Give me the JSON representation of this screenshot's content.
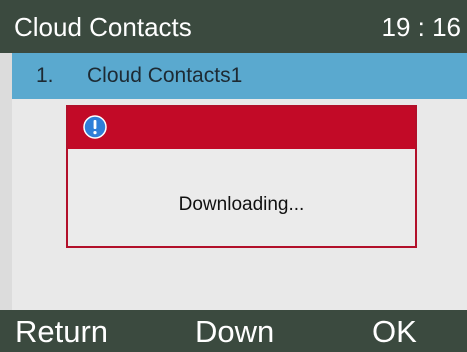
{
  "header": {
    "title": "Cloud Contacts",
    "time": "19 : 16"
  },
  "list": {
    "selected_item": {
      "index": "1.",
      "label": "Cloud Contacts1"
    }
  },
  "dialog": {
    "icon": "info-icon",
    "message": "Downloading..."
  },
  "softkeys": {
    "left": "Return",
    "middle": "Down",
    "right": "OK"
  },
  "colors": {
    "title_bar": "#3b4a3f",
    "selection": "#5aa9cf",
    "dialog_accent": "#c20a27"
  }
}
